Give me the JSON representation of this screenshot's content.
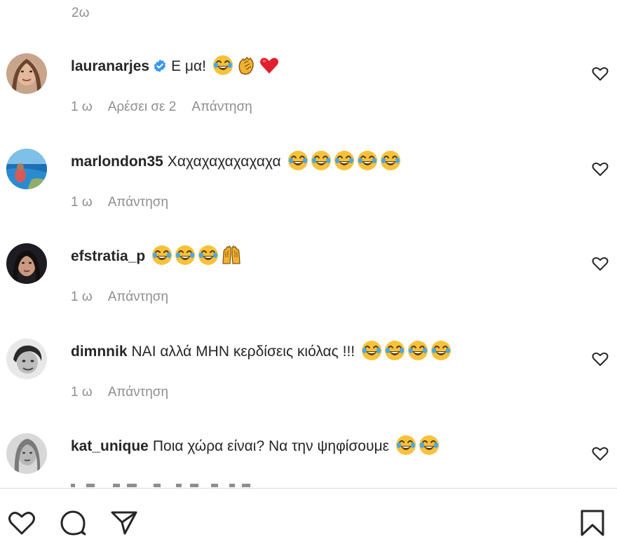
{
  "top_time": "2ω",
  "comments": [
    {
      "username": "lauranarjes",
      "verified": true,
      "text": "Ε μα!",
      "emojis": [
        "joy-emoji",
        "clap-emoji",
        "heart-emoji"
      ],
      "time": "1 ω",
      "likes": "Αρέσει σε 2",
      "reply": "Απάντηση"
    },
    {
      "username": "marlondon35",
      "verified": false,
      "text": "Χαχαχαχαχαχαχα",
      "emojis": [
        "joy-emoji",
        "joy-emoji",
        "joy-emoji",
        "joy-emoji",
        "joy-emoji"
      ],
      "time": "1 ω",
      "reply": "Απάντηση"
    },
    {
      "username": "efstratia_p",
      "verified": false,
      "text": "",
      "emojis": [
        "joy-emoji",
        "joy-emoji",
        "joy-emoji",
        "raised-hands-emoji"
      ],
      "time": "1 ω",
      "reply": "Απάντηση"
    },
    {
      "username": "dimnnik",
      "verified": false,
      "text": "ΝΑΙ αλλά ΜΗΝ κερδίσεις κιόλας !!!",
      "emojis": [
        "joy-emoji",
        "joy-emoji",
        "joy-emoji",
        "joy-emoji"
      ],
      "time": "1 ω",
      "reply": "Απάντηση"
    },
    {
      "username": "kat_unique",
      "verified": false,
      "text": "Ποια χώρα είναι? Να την ψηφίσουμε",
      "emojis": [
        "joy-emoji",
        "joy-emoji"
      ],
      "time": "",
      "reply": ""
    }
  ],
  "action_bar": {
    "icons": [
      "heart-icon",
      "comment-icon",
      "share-icon",
      "bookmark-icon"
    ]
  },
  "colors": {
    "text": "#262626",
    "muted": "#8e8e8e",
    "verified": "#3897f0",
    "divider": "#dbdbdb",
    "emoji_face": "#f7c23b"
  }
}
